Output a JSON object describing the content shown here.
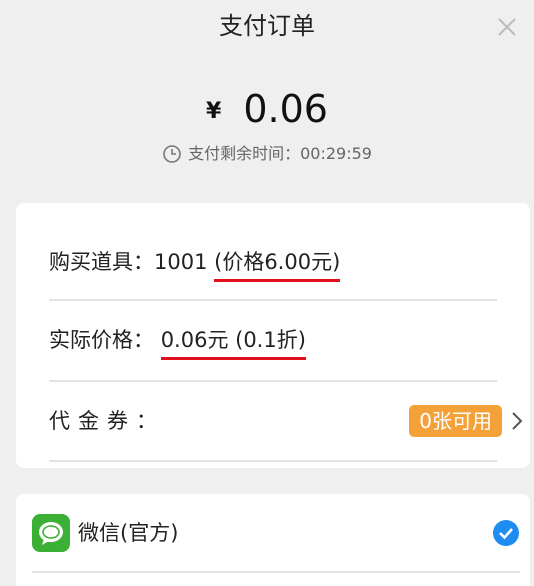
{
  "header": {
    "title": "支付订单"
  },
  "amount": {
    "currency_symbol": "¥",
    "value": "0.06"
  },
  "timer": {
    "label": "支付剩余时间：",
    "remaining": "00:29:59"
  },
  "order": {
    "purchase_label": "购买道具：",
    "purchase_item": "1001 ",
    "purchase_price": "(价格6.00元)",
    "actual_label": "实际价格：",
    "actual_price": "0.06元 (0.1折)",
    "voucher_label": "代金券：",
    "voucher_badge": "0张可用"
  },
  "payment": {
    "method_label": "微信(官方)",
    "selected": true
  },
  "colors": {
    "accent_red": "#e0101e",
    "badge_orange": "#f5a13a",
    "wechat_green": "#3cb034",
    "check_blue": "#1e8cf0"
  }
}
